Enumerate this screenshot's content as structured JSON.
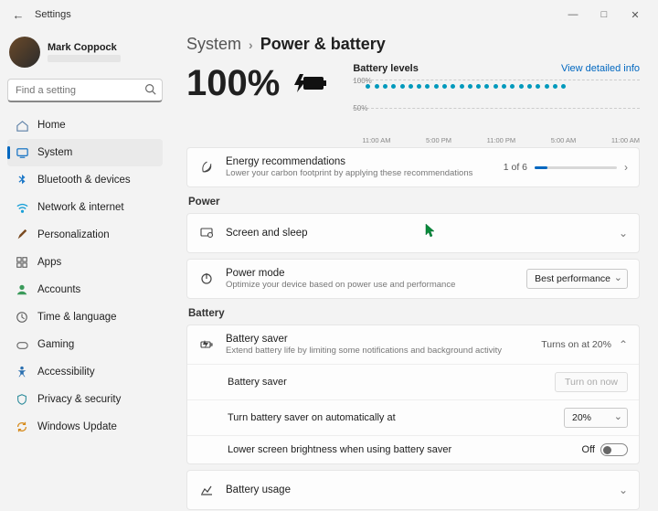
{
  "window": {
    "title": "Settings"
  },
  "profile": {
    "name": "Mark Coppock"
  },
  "search": {
    "placeholder": "Find a setting"
  },
  "sidebar": {
    "items": [
      {
        "label": "Home"
      },
      {
        "label": "System"
      },
      {
        "label": "Bluetooth & devices"
      },
      {
        "label": "Network & internet"
      },
      {
        "label": "Personalization"
      },
      {
        "label": "Apps"
      },
      {
        "label": "Accounts"
      },
      {
        "label": "Time & language"
      },
      {
        "label": "Gaming"
      },
      {
        "label": "Accessibility"
      },
      {
        "label": "Privacy & security"
      },
      {
        "label": "Windows Update"
      }
    ]
  },
  "breadcrumb": {
    "root": "System",
    "page": "Power & battery"
  },
  "battery": {
    "percent": "100%",
    "levels_title": "Battery levels",
    "detail_link": "View detailed info",
    "y100": "100%",
    "y50": "50%",
    "ticks": [
      "11:00 AM",
      "5:00 PM",
      "11:00 PM",
      "5:00 AM",
      "11:00 AM"
    ]
  },
  "energy": {
    "title": "Energy recommendations",
    "desc": "Lower your carbon footprint by applying these recommendations",
    "count": "1 of 6"
  },
  "sections": {
    "power": "Power",
    "battery": "Battery"
  },
  "power": {
    "screen_sleep": "Screen and sleep",
    "mode_title": "Power mode",
    "mode_desc": "Optimize your device based on power use and performance",
    "mode_value": "Best performance"
  },
  "bsaver": {
    "title": "Battery saver",
    "desc": "Extend battery life by limiting some notifications and background activity",
    "status": "Turns on at 20%",
    "row_label": "Battery saver",
    "row_btn": "Turn on now",
    "auto_label": "Turn battery saver on automatically at",
    "auto_value": "20%",
    "bright_label": "Lower screen brightness when using battery saver",
    "bright_state": "Off"
  },
  "usage": {
    "title": "Battery usage"
  }
}
